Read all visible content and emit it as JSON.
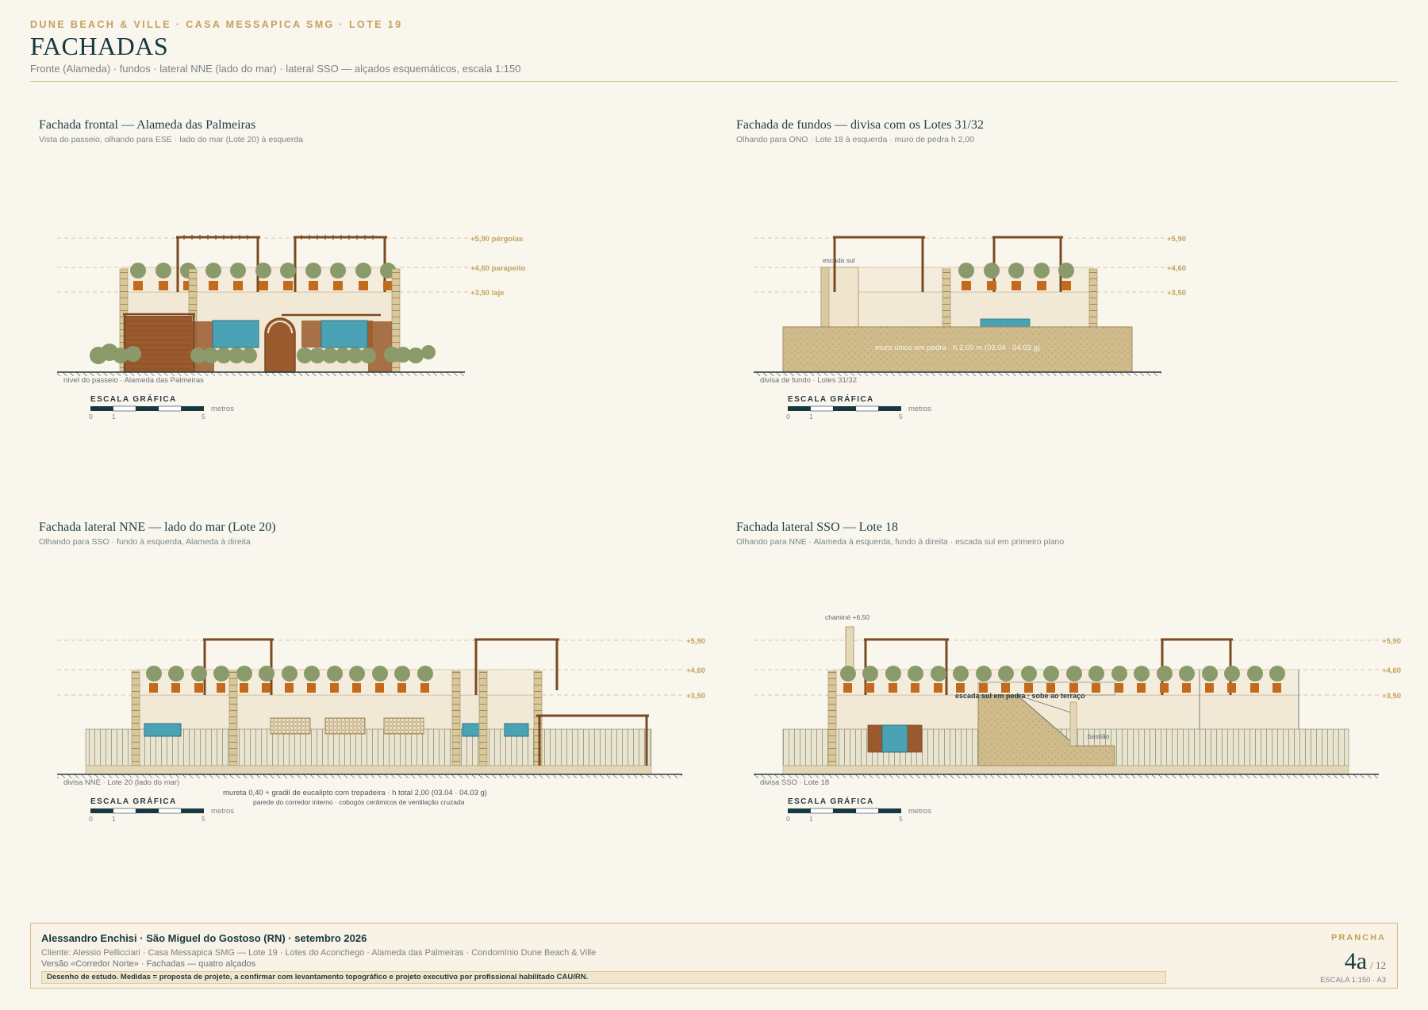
{
  "header": {
    "eyebrow": "DUNE BEACH & VILLE · CASA MESSAPICA SMG · LOTE 19",
    "title": "FACHADAS",
    "subtitle": "Fronte (Alameda) · fundos · lateral NNE (lado do mar) · lateral SSO — alçados esquemáticos, escala 1:150"
  },
  "panels": [
    {
      "title": "Fachada frontal — Alameda das Palmeiras",
      "subtitle": "Vista do passeio, olhando para ESE · lado do mar (Lote 20) à esquerda",
      "levels": [
        "+5,90 pérgolas",
        "+4,60 parapeito",
        "+3,50 laje"
      ],
      "ground_label": "nível do passeio · Alameda das Palmeiras"
    },
    {
      "title": "Fachada de fundos — divisa com os Lotes 31/32",
      "subtitle": "Olhando para ONO · Lote 18 à esquerda · muro de pedra h 2,00",
      "levels": [
        "+5,90",
        "+4,60",
        "+3,50"
      ],
      "ground_label": "divisa de fundo · Lotes 31/32",
      "annotations": [
        "escada sul",
        "muro único em pedra · h 2,00 m (03.04 · 04.03 g)"
      ]
    },
    {
      "title": "Fachada lateral NNE — lado do mar (Lote 20)",
      "subtitle": "Olhando para SSO · fundo à esquerda, Alameda à direita",
      "levels": [
        "+5,90",
        "+4,60",
        "+3,50"
      ],
      "ground_label": "divisa NNE · Lote 20 (lado do mar)",
      "annotations": [
        "mureta 0,40 + gradil de eucalipto com trepadeira · h total 2,00 (03.04 · 04.03 g)",
        "parede do corredor interno · cobogós cerâmicos de ventilação cruzada"
      ]
    },
    {
      "title": "Fachada lateral SSO — Lote 18",
      "subtitle": "Olhando para NNE · Alameda à esquerda, fundo à direita · escada sul em primeiro plano",
      "levels": [
        "+5,90",
        "+4,60",
        "+3,50"
      ],
      "ground_label": "divisa SSO · Lote 18",
      "annotations": [
        "chaminé +6,50",
        "escada sul em pedra · sobe ao terraço",
        "bastião"
      ]
    }
  ],
  "scale_bar": {
    "label": "ESCALA GRÁFICA",
    "unit": "metros",
    "ticks": [
      "0",
      "1",
      "5"
    ]
  },
  "title_block": {
    "author": "Alessandro Enchisi · São Miguel do Gostoso (RN) · setembro 2026",
    "client": "Cliente: Alessio Pellicciari · Casa Messapica SMG — Lote 19 · Lotes do Aconchego · Alameda das Palmeiras · Condomínio Dune Beach & Ville",
    "version": "Versão «Corredor Norte» · Fachadas — quatro alçados",
    "disclaimer": "Desenho de estudo. Medidas = proposta de projeto, a confirmar com levantamento topográfico e projeto executivo por profissional habilitado CAU/RN.",
    "prancha_label": "PRANCHA",
    "sheet": "4a",
    "total": "/ 12",
    "scale": "ESCALA 1:150 · A3"
  },
  "colors": {
    "gold": "#c4a15d",
    "navy": "#163840",
    "wood": "#7a4a22",
    "planter": "#c46a1c",
    "tree": "#8a9a6b",
    "stone": "#cdb88a",
    "wall": "#f2e8d6",
    "pool": "#4aa3b5"
  }
}
